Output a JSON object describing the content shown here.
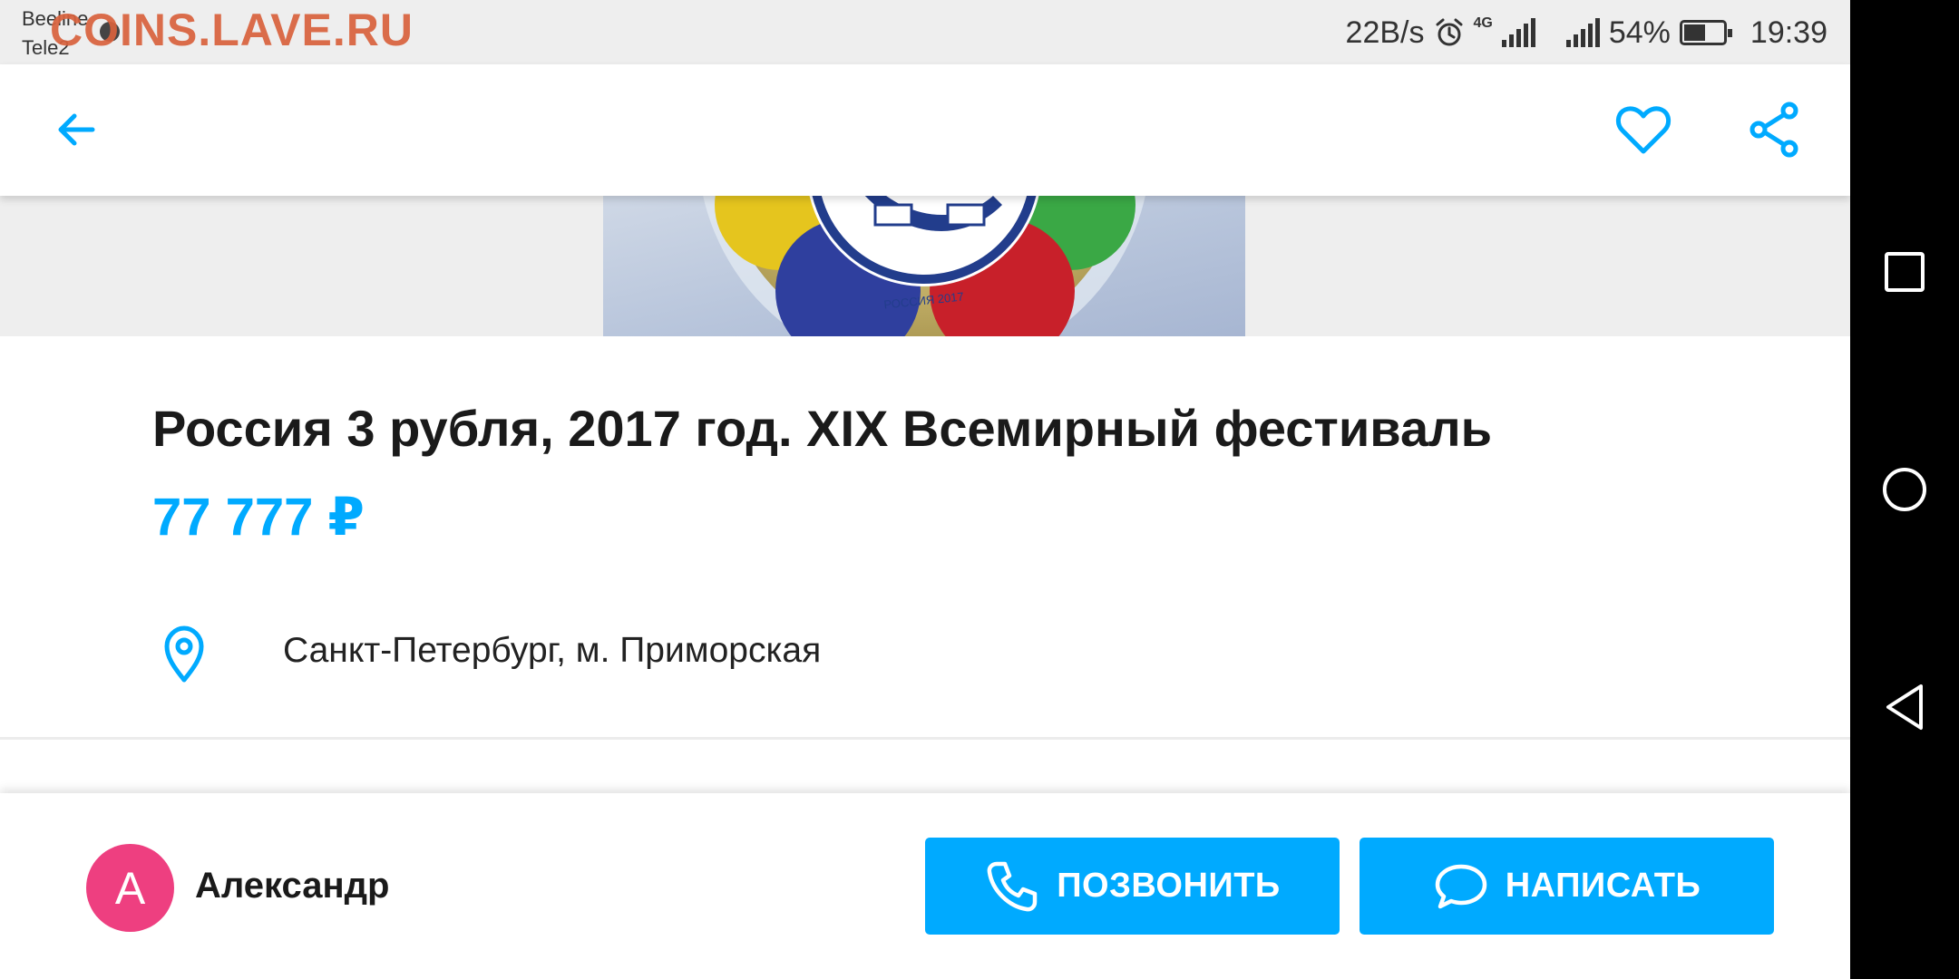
{
  "status_bar": {
    "carrier_1": "Beeline",
    "carrier_2": "Tele2",
    "watermark": "COINS.LAVE.RU",
    "net_speed": "22B/s",
    "network_type": "4G",
    "battery_percent": "54%",
    "battery_level": 0.54,
    "time": "19:39"
  },
  "app_bar": {
    "back_icon": "arrow-left",
    "favorite_icon": "heart-outline",
    "share_icon": "share"
  },
  "listing": {
    "title": "Россия 3 рубля, 2017 год. XIX Всемирный фестиваль",
    "price": "77 777 ₽",
    "location_icon": "map-pin",
    "location": "Санкт-Петербург, м. Приморская",
    "photo_caption": "РОССИЯ 2017"
  },
  "seller": {
    "avatar_letter": "А",
    "name": "Александр"
  },
  "actions": {
    "call_label": "ПОЗВОНИТЬ",
    "write_label": "НАПИСАТЬ"
  },
  "colors": {
    "accent": "#00aaff",
    "avatar": "#ee3f80",
    "watermark": "#d9623d"
  },
  "system_nav": [
    "recent-apps",
    "home",
    "back"
  ]
}
